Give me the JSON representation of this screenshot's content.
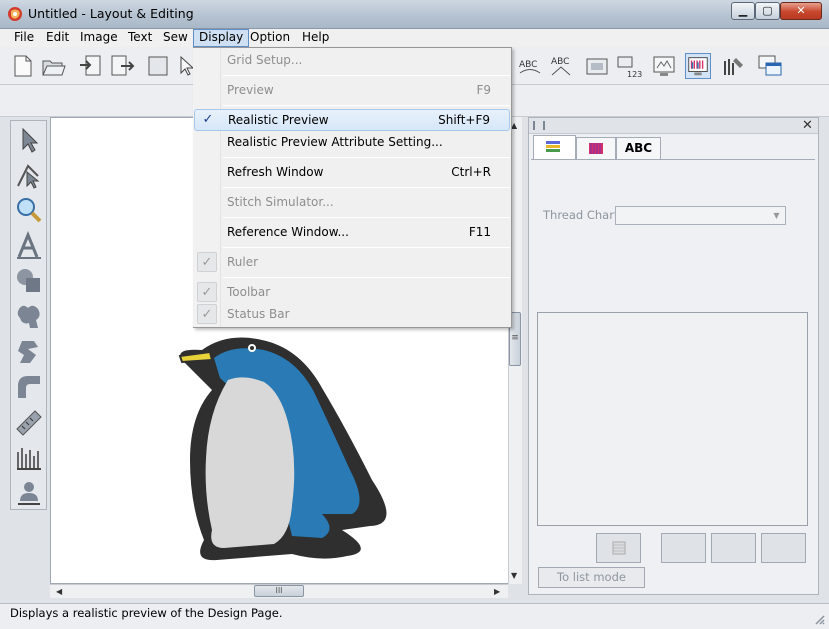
{
  "window": {
    "title": "Untitled - Layout & Editing",
    "minimize_glyph": "▁",
    "maximize_glyph": "▢",
    "close_glyph": "✕"
  },
  "menubar": {
    "items": [
      "File",
      "Edit",
      "Image",
      "Text",
      "Sew",
      "Display",
      "Option",
      "Help"
    ],
    "open_item": "Display"
  },
  "display_menu": {
    "items": [
      {
        "label": "Grid Setup...",
        "shortcut": "",
        "disabled": true,
        "checked": false
      },
      {
        "label": "Preview",
        "shortcut": "F9",
        "disabled": true,
        "checked": false
      },
      {
        "label": "Realistic Preview",
        "shortcut": "Shift+F9",
        "disabled": false,
        "checked": true
      },
      {
        "label": "Realistic Preview Attribute Setting...",
        "shortcut": "",
        "disabled": false,
        "checked": false
      },
      {
        "label": "Refresh Window",
        "shortcut": "Ctrl+R",
        "disabled": false,
        "checked": false
      },
      {
        "label": "Stitch Simulator...",
        "shortcut": "",
        "disabled": true,
        "checked": false
      },
      {
        "label": "Reference Window...",
        "shortcut": "F11",
        "disabled": false,
        "checked": false
      },
      {
        "label": "Ruler",
        "shortcut": "",
        "disabled": true,
        "checked": true
      },
      {
        "label": "Toolbar",
        "shortcut": "",
        "disabled": true,
        "checked": true
      },
      {
        "label": "Status Bar",
        "shortcut": "",
        "disabled": true,
        "checked": true
      }
    ],
    "check_glyph": "✓"
  },
  "toolbar": {
    "icons": [
      "new-file-icon",
      "open-file-icon",
      "import-design-icon",
      "export-design-icon",
      "design-page-icon",
      "select-icon",
      "text-arc-icon",
      "text-outline-icon",
      "design-center-icon",
      "stitch-count-icon",
      "preview-window-icon",
      "realistic-preview-icon",
      "sew-machine-icon",
      "reference-window-icon"
    ]
  },
  "tools": {
    "icons": [
      "select-arrow-icon",
      "point-edit-icon",
      "zoom-icon",
      "text-tool-icon",
      "shape-tool-icon",
      "stamp-tool-icon",
      "manual-punch-icon",
      "outline-tool-icon",
      "measure-tool-icon",
      "sew-attribute-icon",
      "figure-icon"
    ]
  },
  "right_panel": {
    "tabs": [
      {
        "name": "thread-list-tab",
        "label": ""
      },
      {
        "name": "thread-color-tab",
        "label": ""
      },
      {
        "name": "text-tab",
        "label": "ABC"
      }
    ],
    "thread_chart_label": "Thread Chart:",
    "thread_chart_value": "",
    "list_mode_button": "To list mode",
    "grip_glyph": "||||",
    "close_glyph": "✕"
  },
  "canvas": {
    "design": "penguin embroidery",
    "colors": {
      "outline": "#2f2f2f",
      "body_blue": "#2a7bb5",
      "belly": "#d8d8d8",
      "beak": "#e8d23a"
    }
  },
  "scrollbars": {
    "v_grip": "≡",
    "h_grip": "III",
    "up_arrow": "▲",
    "down_arrow": "▼",
    "left_arrow": "◀",
    "right_arrow": "▶"
  },
  "statusbar": {
    "text": "Displays a realistic preview of the Design Page."
  }
}
